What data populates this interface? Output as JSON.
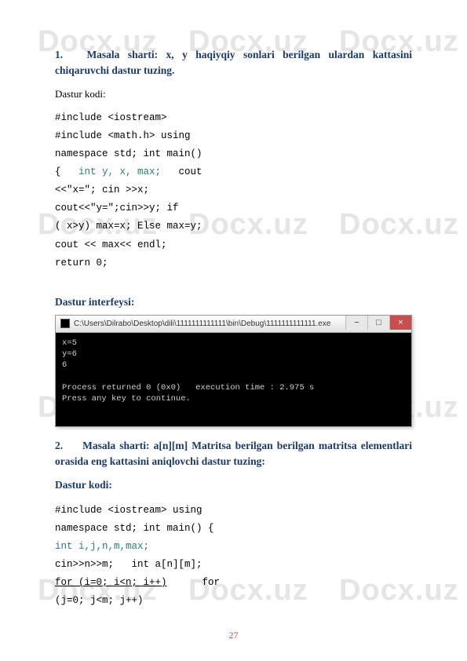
{
  "watermark": "Docx.uz",
  "section1": {
    "num": "1.",
    "heading": "Masala sharti: x, y haqiyqiy sonlari berilgan ulardan kattasini chiqaruvchi dastur tuzing.",
    "pretext": "Dastur kodi:",
    "code": {
      "l1": "#include <iostream>",
      "l2": "#include <math.h> using",
      "l3": "namespace std; int main()",
      "l4a": "{   ",
      "l4b": "int y, x, max;",
      "l4c": "   cout",
      "l5": "<<\"x=\"; cin >>x;",
      "l6": "cout<<\"y=\";cin>>y; if",
      "l7": "( x>y) max=x; Else max=y;",
      "l8": "cout << max<< endl;",
      "l9": "return 0;"
    }
  },
  "interfeysi": "Dastur interfeysi:",
  "console": {
    "title": "C:\\Users\\Dilrabo\\Desktop\\dili\\1111111111111\\bin\\Debug\\1111111111111.exe",
    "body": "x=5\ny=6\n6\n\nProcess returned 0 (0x0)   execution time : 2.975 s\nPress any key to continue.\n"
  },
  "win_buttons": {
    "min": "−",
    "max": "□",
    "close": "×"
  },
  "section2": {
    "num": "2.",
    "heading": "Masala sharti: a[n][m] Matritsa berilgan berilgan matritsa elementlari orasida eng kattasini aniqlovchi dastur tuzing:",
    "pretext": "Dastur kodi:",
    "code": {
      "l1": "#include <iostream> using",
      "l2": "namespace std; int main() {",
      "l3": "int i,j,n,m,max;",
      "l4": "cin>>n>>m;   int a[n][m];",
      "l5a": "for (i=0; i<n; i++)",
      "l5b": "      for",
      "l6": "(j=0; j<m; j++)"
    }
  },
  "page_number": "27"
}
